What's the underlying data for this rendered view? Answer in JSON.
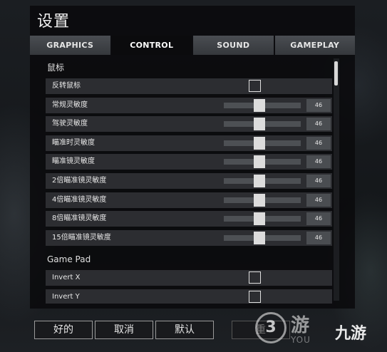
{
  "title": "设置",
  "tabs": [
    {
      "label": "GRAPHICS",
      "active": false
    },
    {
      "label": "CONTROL",
      "active": true
    },
    {
      "label": "SOUND",
      "active": false
    },
    {
      "label": "GAMEPLAY",
      "active": false
    }
  ],
  "sections": {
    "mouse": {
      "title": "鼠标",
      "invert": {
        "label": "反转鼠标",
        "checked": false
      },
      "sliders": [
        {
          "label": "常规灵敏度",
          "value": "46",
          "fraction": 0.46
        },
        {
          "label": "驾驶灵敏度",
          "value": "46",
          "fraction": 0.46
        },
        {
          "label": "瞄准时灵敏度",
          "value": "46",
          "fraction": 0.46
        },
        {
          "label": "瞄准镜灵敏度",
          "value": "46",
          "fraction": 0.46
        },
        {
          "label": "2倍瞄准镜灵敏度",
          "value": "46",
          "fraction": 0.46
        },
        {
          "label": "4倍瞄准镜灵敏度",
          "value": "46",
          "fraction": 0.46
        },
        {
          "label": "8倍瞄准镜灵敏度",
          "value": "46",
          "fraction": 0.46
        },
        {
          "label": "15倍瞄准镜灵敏度",
          "value": "46",
          "fraction": 0.46
        }
      ]
    },
    "gamepad": {
      "title": "Game Pad",
      "invert_x": {
        "label": "Invert X",
        "checked": false
      },
      "invert_y": {
        "label": "Invert Y",
        "checked": false
      }
    }
  },
  "buttons": {
    "ok": "好的",
    "cancel": "取消",
    "default": "默认",
    "reset": "重"
  },
  "watermark": {
    "badge": "3",
    "main": "游",
    "sub": "YOU",
    "brand": "九游"
  },
  "colors": {
    "panel": "#0a0a0c",
    "tab_inactive": "#4a4d52",
    "tab_active": "#0b0b0d",
    "row": "#3a3c40",
    "thumb": "#dcdcdc"
  }
}
